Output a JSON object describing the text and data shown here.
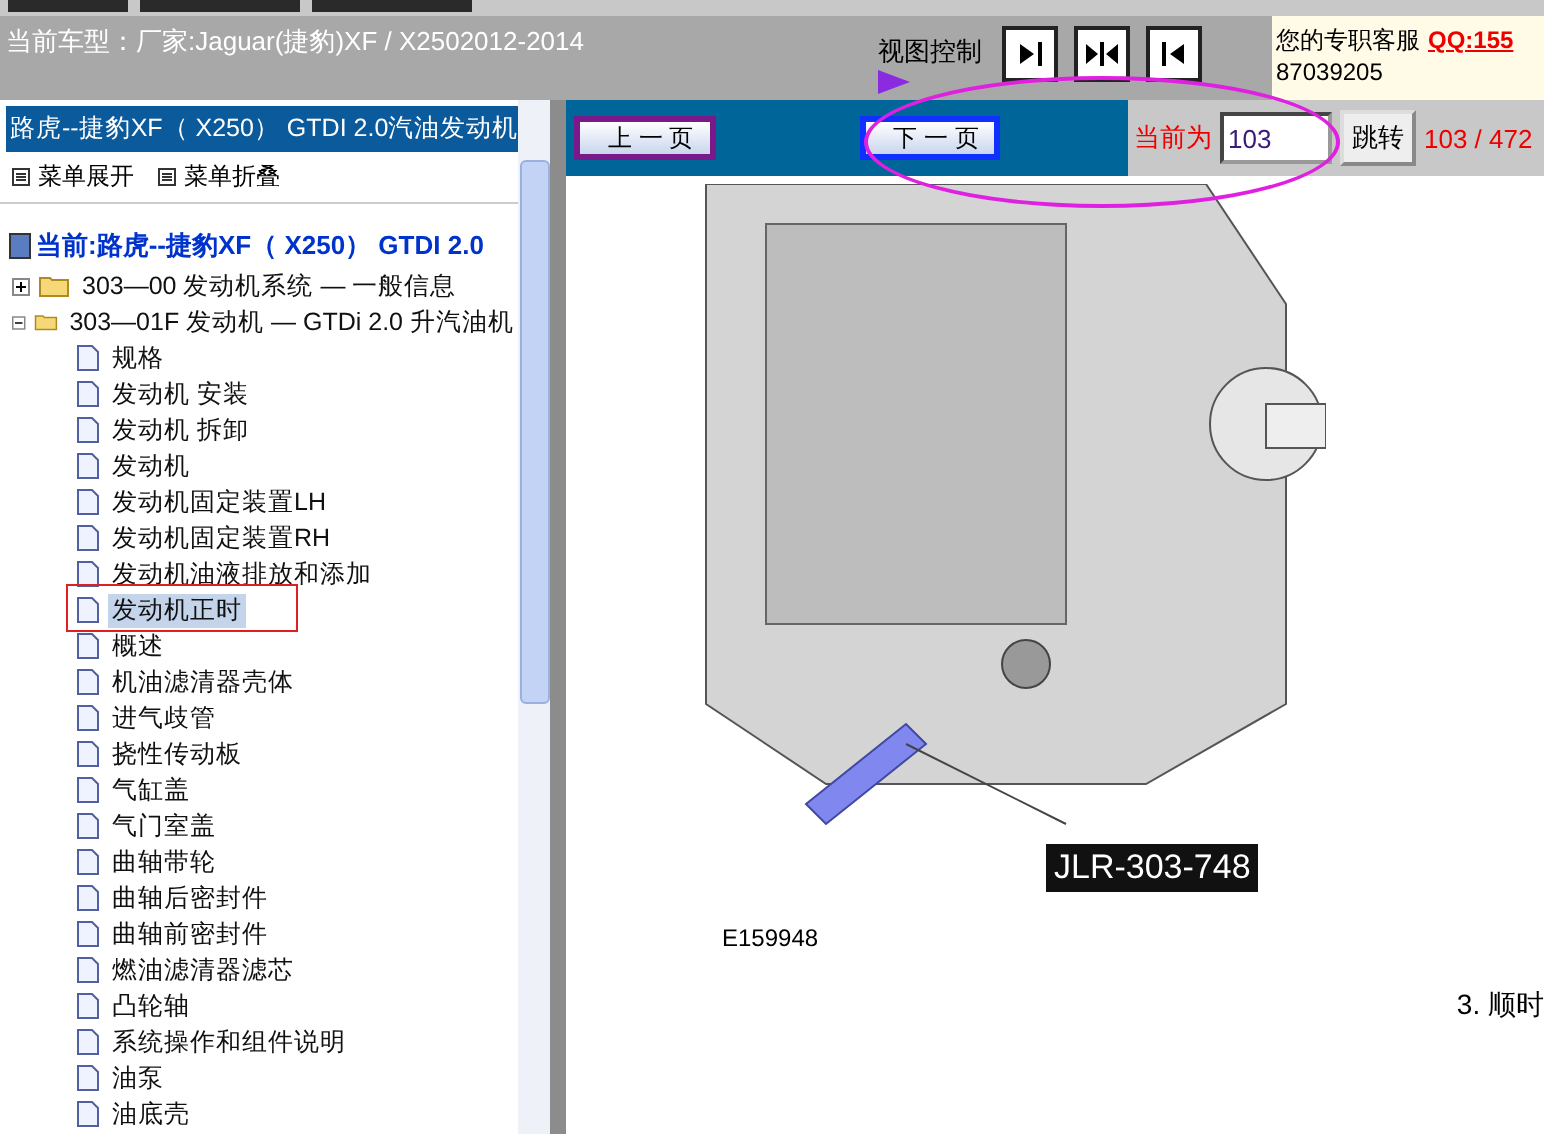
{
  "header": {
    "vehicle": "当前车型：厂家:Jaguar(捷豹)XF / X2502012-2014",
    "view_control": "视图控制",
    "service": {
      "label": "您的专职客服",
      "qq": "QQ:155",
      "phone": "87039205"
    }
  },
  "sidebar": {
    "title": "路虎--捷豹XF（ X250） GTDI 2.0汽油发动机",
    "actions": [
      "菜单展开",
      "菜单折叠"
    ],
    "tree": {
      "label": "当前:路虎--捷豹XF（ X250） GTDI 2.0",
      "children": [
        {
          "label": "303—00 发动机系统 — 一般信息",
          "expanded": false
        },
        {
          "label": "303—01F 发动机 — GTDi 2.0 升汽油机",
          "expanded": true,
          "children": [
            {
              "label": "规格",
              "selected": false
            },
            {
              "label": "发动机 安装",
              "selected": false
            },
            {
              "label": "发动机 拆卸",
              "selected": false
            },
            {
              "label": "发动机",
              "selected": false
            },
            {
              "label": "发动机固定装置LH",
              "selected": false
            },
            {
              "label": "发动机固定装置RH",
              "selected": false
            },
            {
              "label": "发动机油液排放和添加",
              "selected": false
            },
            {
              "label": "发动机正时",
              "selected": true
            },
            {
              "label": "概述",
              "selected": false
            },
            {
              "label": "机油滤清器壳体",
              "selected": false
            },
            {
              "label": "进气歧管",
              "selected": false
            },
            {
              "label": "挠性传动板",
              "selected": false
            },
            {
              "label": "气缸盖",
              "selected": false
            },
            {
              "label": "气门室盖",
              "selected": false
            },
            {
              "label": "曲轴带轮",
              "selected": false
            },
            {
              "label": "曲轴后密封件",
              "selected": false
            },
            {
              "label": "曲轴前密封件",
              "selected": false
            },
            {
              "label": "燃油滤清器滤芯",
              "selected": false
            },
            {
              "label": "凸轮轴",
              "selected": false
            },
            {
              "label": "系统操作和组件说明",
              "selected": false
            },
            {
              "label": "油泵",
              "selected": false
            },
            {
              "label": "油底壳",
              "selected": false
            }
          ]
        }
      ]
    }
  },
  "pager": {
    "prev": "上 一 页",
    "next": "下 一 页",
    "current_label": "当前为",
    "page": "103",
    "go": "跳转",
    "count": "103 / 472"
  },
  "document": {
    "tool_label": "JLR-303-748",
    "figure_id": "E159948",
    "step": "3.  顺时"
  }
}
